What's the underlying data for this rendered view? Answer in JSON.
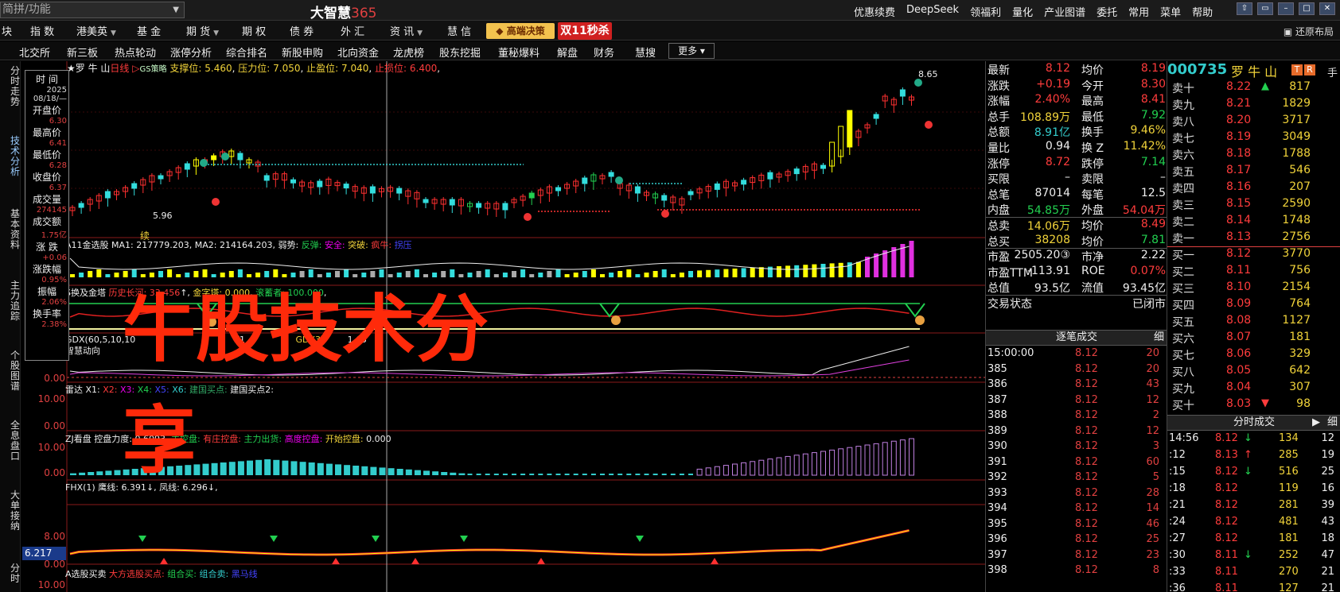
{
  "titlebar": {
    "search_placeholder": "简拼/功能",
    "brand_name": "大智慧",
    "brand_num": "365",
    "menu": [
      "优惠续费",
      "DeepSeek",
      "领福利",
      "量化",
      "产业图谱",
      "委托",
      "常用",
      "菜单",
      "帮助"
    ]
  },
  "menurow": {
    "items": [
      "块",
      "指 数",
      "港美英",
      "基 金",
      "期 货",
      "期 权",
      "债 券",
      "外 汇",
      "资 讯",
      "慧 信"
    ],
    "gaoduan": "高端决策",
    "shuang": "双11秒杀",
    "restore": "还原布局"
  },
  "subtabs": {
    "items": [
      "北交所",
      "新三板",
      "热点轮动",
      "涨停分析",
      "综合排名",
      "新股申购",
      "北向资金",
      "龙虎榜",
      "股东挖掘",
      "董秘爆料",
      "解盘",
      "财务",
      "慧搜"
    ],
    "more": "更多"
  },
  "lefttabs": [
    "分时走势",
    "技术分析",
    "基本资料",
    "主力追踪",
    "个股图谱",
    "全息盘口",
    "大单接纳",
    "分时"
  ],
  "chart_head": {
    "stock": "罗 牛 山",
    "period": "日线",
    "strategy": "GS策略",
    "support_label": "支撑位:",
    "support": "5.460",
    "pressure_label": "压力位:",
    "pressure": "7.050",
    "takeprofit_label": "止盈位:",
    "takeprofit": "7.040",
    "stoploss_label": "止损位:",
    "stoploss": "6.400",
    "high_label": "8.65",
    "low_label": "5.96",
    "xu": "续"
  },
  "infobox": {
    "time_label": "时 间",
    "year": "2025",
    "date": "08/18/—",
    "rows": [
      {
        "k": "开盘价",
        "v": "6.30"
      },
      {
        "k": "最高价",
        "v": "6.41"
      },
      {
        "k": "最低价",
        "v": "6.28"
      },
      {
        "k": "收盘价",
        "v": "6.37"
      },
      {
        "k": "成交量",
        "v": "274145"
      },
      {
        "k": "成交额",
        "v": "1.75亿"
      },
      {
        "k": "涨 跌",
        "v": "+0.06"
      },
      {
        "k": "涨跌幅",
        "v": "0.95%"
      },
      {
        "k": "振幅",
        "v": "2.06%"
      },
      {
        "k": "换手率",
        "v": "2.38%"
      }
    ]
  },
  "panels": {
    "p2": {
      "name": "A11金选股",
      "ma1_label": "MA1:",
      "ma1": "217779.203",
      "ma2_label": "MA2:",
      "ma2": "214164.203",
      "tags": [
        "弱势:",
        "反弹:",
        "安全:",
        "突破:",
        "疯牛:",
        "拐压"
      ]
    },
    "p3": {
      "name": "S换及金塔",
      "h1": "历史长河:",
      "h1v": "33.456",
      "h2": "金字塔:",
      "h2v": "0.000",
      "h3": "滚蓄者:",
      "h3v": "100.000"
    },
    "p4": {
      "name": "GDX(60,5,10,10",
      "sub": "智慧动向",
      "k": "K1",
      "gdx3": "GDX3",
      "tail": "1.65",
      "y": "0.00"
    },
    "p5": {
      "name": "雷达",
      "x1": "X1:",
      "x2": "X2:",
      "x3": "X3:",
      "x4": "X4:",
      "x5": "X5:",
      "x6": "X6:",
      "b1": "建国买点:",
      "b2": "建国买点2:",
      "y1": "10.00",
      "y2": "0.00"
    },
    "p6": {
      "name": "ZJ看盘",
      "t1": "控盘力度:",
      "t1v": "0.6093",
      "t2": "主控盘:",
      "t3": "有庄控盘:",
      "t4": "主力出货:",
      "t5": "高度控盘:",
      "t6": "开始控盘:",
      "t6v": "0.000",
      "y1": "10.00",
      "y2": "0.00"
    },
    "p7": {
      "name": "FHX(1)",
      "l1": "鹰线:",
      "l1v": "6.391",
      "l2": "凤线:",
      "l2v": "6.296",
      "y1": "8.00",
      "y2": "0.00",
      "price": "6.217"
    },
    "p8": {
      "name": "A选股买卖",
      "t1": "大方选股买点:",
      "t2": "组合买:",
      "t3": "组合卖:",
      "t4": "黑马线",
      "y": "10.00"
    }
  },
  "overlay": {
    "line1": "牛股技术分",
    "line2": "享"
  },
  "quote": {
    "rows": [
      {
        "a": "最新",
        "b": "8.12",
        "bc": "red",
        "c": "均价",
        "d": "8.19",
        "dc": "red"
      },
      {
        "a": "涨跌",
        "b": "+0.19",
        "bc": "red",
        "c": "今开",
        "d": "8.30",
        "dc": "red"
      },
      {
        "a": "涨幅",
        "b": "2.40%",
        "bc": "red",
        "c": "最高",
        "d": "8.41",
        "dc": "red"
      },
      {
        "a": "总手",
        "b": "108.89万",
        "bc": "yellow",
        "c": "最低",
        "d": "7.92",
        "dc": "green"
      },
      {
        "a": "总额",
        "b": "8.91亿",
        "bc": "cyan",
        "c": "换手",
        "d": "9.46%",
        "dc": "yellow"
      },
      {
        "a": "量比",
        "b": "0.94",
        "bc": "white",
        "c": "换 Z",
        "d": "11.42%",
        "dc": "yellow"
      },
      {
        "a": "涨停",
        "b": "8.72",
        "bc": "red",
        "c": "跌停",
        "d": "7.14",
        "dc": "green"
      },
      {
        "a": "买限",
        "b": "–",
        "bc": "white",
        "c": "卖限",
        "d": "–",
        "dc": "white"
      },
      {
        "a": "总笔",
        "b": "87014",
        "bc": "white",
        "c": "每笔",
        "d": "12.5",
        "dc": "white"
      },
      {
        "a": "内盘",
        "b": "54.85万",
        "bc": "green",
        "c": "外盘",
        "d": "54.04万",
        "dc": "red"
      },
      {
        "a": "总卖",
        "b": "14.06万",
        "bc": "yellow",
        "c": "均价",
        "d": "8.49",
        "dc": "red"
      },
      {
        "a": "总买",
        "b": "38208",
        "bc": "yellow",
        "c": "均价",
        "d": "7.81",
        "dc": "green"
      },
      {
        "a": "市盈",
        "b": "2505.20③",
        "bc": "white",
        "c": "市净",
        "d": "2.22",
        "dc": "white"
      },
      {
        "a": "市盈TTM",
        "b": "-113.91",
        "bc": "white",
        "c": "ROE",
        "d": "0.07%",
        "dc": "red"
      },
      {
        "a": "总值",
        "b": "93.5亿",
        "bc": "white",
        "c": "流值",
        "d": "93.45亿",
        "dc": "white"
      },
      {
        "a": "交易状态",
        "b": "",
        "bc": "white",
        "c": "",
        "d": "已闭市",
        "dc": "white"
      }
    ],
    "ticks_head": "逐笔成交",
    "ticks_tail": "细",
    "ticks": [
      {
        "t": "15:00:00",
        "p": "8.12",
        "v": "20"
      },
      {
        "t": "385",
        "p": "8.12",
        "v": "20"
      },
      {
        "t": "386",
        "p": "8.12",
        "v": "43"
      },
      {
        "t": "387",
        "p": "8.12",
        "v": "12"
      },
      {
        "t": "388",
        "p": "8.12",
        "v": "2"
      },
      {
        "t": "389",
        "p": "8.12",
        "v": "12"
      },
      {
        "t": "390",
        "p": "8.12",
        "v": "3"
      },
      {
        "t": "391",
        "p": "8.12",
        "v": "60"
      },
      {
        "t": "392",
        "p": "8.12",
        "v": "5"
      },
      {
        "t": "393",
        "p": "8.12",
        "v": "28"
      },
      {
        "t": "394",
        "p": "8.12",
        "v": "14"
      },
      {
        "t": "395",
        "p": "8.12",
        "v": "46"
      },
      {
        "t": "396",
        "p": "8.12",
        "v": "25"
      },
      {
        "t": "397",
        "p": "8.12",
        "v": "23"
      },
      {
        "t": "398",
        "p": "8.12",
        "v": "8"
      }
    ]
  },
  "book": {
    "code": "000735",
    "name": "罗 牛 山",
    "badge1": "T",
    "badge2": "R",
    "hand": "手",
    "rows": [
      {
        "l": "卖十",
        "p": "8.22",
        "pc": "red",
        "q": "817",
        "arrow": "up"
      },
      {
        "l": "卖九",
        "p": "8.21",
        "pc": "red",
        "q": "1829",
        "arrow": ""
      },
      {
        "l": "卖八",
        "p": "8.20",
        "pc": "red",
        "q": "3717",
        "arrow": ""
      },
      {
        "l": "卖七",
        "p": "8.19",
        "pc": "red",
        "q": "3049",
        "arrow": ""
      },
      {
        "l": "卖六",
        "p": "8.18",
        "pc": "red",
        "q": "1788",
        "arrow": ""
      },
      {
        "l": "卖五",
        "p": "8.17",
        "pc": "red",
        "q": "546",
        "arrow": ""
      },
      {
        "l": "卖四",
        "p": "8.16",
        "pc": "red",
        "q": "207",
        "arrow": ""
      },
      {
        "l": "卖三",
        "p": "8.15",
        "pc": "red",
        "q": "2590",
        "arrow": ""
      },
      {
        "l": "卖二",
        "p": "8.14",
        "pc": "red",
        "q": "1748",
        "arrow": ""
      },
      {
        "l": "卖一",
        "p": "8.13",
        "pc": "red",
        "q": "2756",
        "arrow": ""
      },
      {
        "l": "买一",
        "p": "8.12",
        "pc": "red",
        "q": "3770",
        "arrow": ""
      },
      {
        "l": "买二",
        "p": "8.11",
        "pc": "red",
        "q": "756",
        "arrow": ""
      },
      {
        "l": "买三",
        "p": "8.10",
        "pc": "red",
        "q": "2154",
        "arrow": ""
      },
      {
        "l": "买四",
        "p": "8.09",
        "pc": "red",
        "q": "764",
        "arrow": ""
      },
      {
        "l": "买五",
        "p": "8.08",
        "pc": "red",
        "q": "1127",
        "arrow": ""
      },
      {
        "l": "买六",
        "p": "8.07",
        "pc": "red",
        "q": "181",
        "arrow": ""
      },
      {
        "l": "买七",
        "p": "8.06",
        "pc": "red",
        "q": "329",
        "arrow": ""
      },
      {
        "l": "买八",
        "p": "8.05",
        "pc": "red",
        "q": "642",
        "arrow": ""
      },
      {
        "l": "买九",
        "p": "8.04",
        "pc": "red",
        "q": "307",
        "arrow": ""
      },
      {
        "l": "买十",
        "p": "8.03",
        "pc": "red",
        "q": "98",
        "arrow": "down"
      }
    ],
    "tick2_head": "分时成交",
    "tick2_tail": "细",
    "ticks": [
      {
        "t": "14:56",
        "p": "8.12",
        "pc": "red",
        "ar": "↓",
        "v": "134",
        "n": "12"
      },
      {
        "t": ":12",
        "p": "8.13",
        "pc": "red",
        "ar": "↑",
        "v": "285",
        "n": "19"
      },
      {
        "t": ":15",
        "p": "8.12",
        "pc": "red",
        "ar": "↓",
        "v": "516",
        "n": "25"
      },
      {
        "t": ":18",
        "p": "8.12",
        "pc": "red",
        "ar": "",
        "v": "119",
        "n": "16"
      },
      {
        "t": ":21",
        "p": "8.12",
        "pc": "red",
        "ar": "",
        "v": "281",
        "n": "39"
      },
      {
        "t": ":24",
        "p": "8.12",
        "pc": "red",
        "ar": "",
        "v": "481",
        "n": "43"
      },
      {
        "t": ":27",
        "p": "8.12",
        "pc": "red",
        "ar": "",
        "v": "181",
        "n": "18"
      },
      {
        "t": ":30",
        "p": "8.11",
        "pc": "red",
        "ar": "↓",
        "v": "252",
        "n": "47"
      },
      {
        "t": ":33",
        "p": "8.11",
        "pc": "red",
        "ar": "",
        "v": "270",
        "n": "21"
      },
      {
        "t": ":36",
        "p": "8.11",
        "pc": "red",
        "ar": "",
        "v": "127",
        "n": "21"
      }
    ]
  }
}
